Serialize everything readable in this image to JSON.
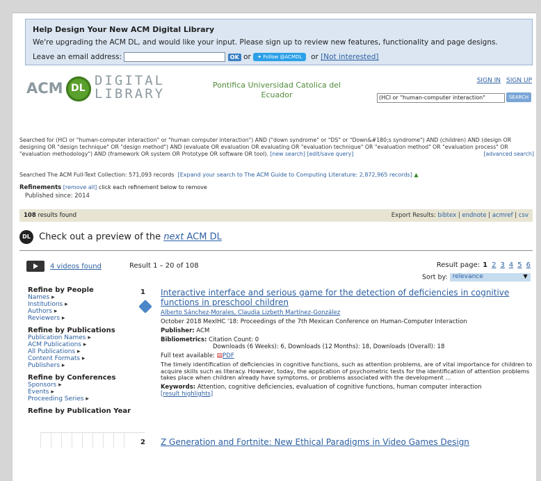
{
  "banner": {
    "title": "Help Design Your New ACM Digital Library",
    "text": "We're upgrading the ACM DL, and would like your input.  Please sign up to review new features, functionality and page designs.",
    "email_label": "Leave an email address:",
    "email_value": "",
    "ok_label": "OK",
    "or1": "or",
    "follow_label": "Follow @ACMDL",
    "or2": "or",
    "not_interested": "[Not interested]"
  },
  "logo": {
    "acm": "ACM",
    "dl": "DL",
    "digital": "DIGITAL",
    "library": "LIBRARY"
  },
  "institution": "Pontifica Universidad Catolica del Ecuador",
  "header": {
    "sign_in": "SIGN IN",
    "sign_up": "SIGN UP",
    "search_value": "(HCI or \"human-computer interaction\"",
    "search_button": "SEARCH"
  },
  "query": {
    "text": "Searched for (HCI or \"human-computer interaction\" or \"human computer interaction\") AND (\"down syndrome\" or \"DS\" or \"Down&#180;s syndrome\") AND (children) AND (design OR designing OR \"design technique\" OR \"design method\") AND (evaluate OR evaluation OR evaluating OR \"evaluation technique\" OR \"evaluation method\" OR \"evaluation process\" OR \"evaluation methodology\") AND (framework OR system OR Prototype OR software OR tool).",
    "new_search": "[new search]",
    "edit_save": "[edit/save query]",
    "advanced": "[advanced search]"
  },
  "collection": {
    "text": "Searched The ACM Full-Text Collection: 571,093 records",
    "expand": "[Expand your search to The ACM Guide to Computing Literature: 2,872,965 records]"
  },
  "refinements": {
    "label": "Refinements",
    "remove_all": "[remove all]",
    "hint": "click each refinement below to remove",
    "published": "Published since: 2014"
  },
  "results_bar": {
    "count": "108",
    "found": "results found",
    "export_label": "Export Results:",
    "exports": [
      "bibtex",
      "endnote",
      "acmref",
      "csv"
    ]
  },
  "preview": {
    "icon": "DL",
    "text": "Check out a preview of the",
    "link_next": "next",
    "link_rest": "ACM DL"
  },
  "videos": {
    "label": "4 videos found"
  },
  "range": "Result 1 – 20 of 108",
  "pagination": {
    "label": "Result page:",
    "current": "1",
    "pages": [
      "2",
      "3",
      "4",
      "5",
      "6"
    ]
  },
  "sort": {
    "label": "Sort by:",
    "value": "relevance"
  },
  "sidebar": {
    "people_hdr": "Refine by People",
    "people": [
      "Names",
      "Institutions",
      "Authors",
      "Reviewers"
    ],
    "pubs_hdr": "Refine by Publications",
    "pubs": [
      "Publication Names",
      "ACM Publications",
      "All Publications",
      "Content Formats",
      "Publishers"
    ],
    "conf_hdr": "Refine by Conferences",
    "conf": [
      "Sponsors",
      "Events",
      "Proceeding Series"
    ],
    "year_hdr": "Refine by Publication Year"
  },
  "results": [
    {
      "num": "1",
      "title": "Interactive interface and serious game for the detection of deficiencies in cognitive functions in preschool children",
      "authors": "Alberto Sánchez-Morales, Claudia Lizbeth Martínez-González",
      "venue": "October 2018  MexIHC '18: Proceedings of the 7th Mexican Conference on Human-Computer Interaction",
      "publisher_label": "Publisher:",
      "publisher": "ACM",
      "biblio_label": "Bibliometrics:",
      "biblio1": "Citation Count: 0",
      "biblio2": "Downloads (6 Weeks): 6,   Downloads (12 Months): 18,   Downloads (Overall): 18",
      "fulltext_label": "Full text available:",
      "pdf": "PDF",
      "abstract": "The timely identification of deficiencies in cognitive functions, such as attention problems, are of vital importance for children to acquire skills such as literacy. However, today, the application of psychometric tests for the identification of attention problems takes place when children already have symptoms, or problems associated with the development ...",
      "keywords_label": "Keywords:",
      "keywords": "Attention, cognitive deficiencies, evaluation of cognitive functions, human computer interaction",
      "highlights": "[result highlights]"
    },
    {
      "num": "2",
      "title": "Z Generation and Fortnite: New Ethical Paradigms in Video Games Design"
    }
  ]
}
